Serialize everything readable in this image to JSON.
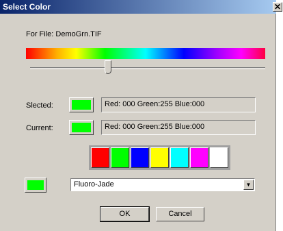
{
  "window": {
    "title": "Select Color",
    "close_glyph": "✕"
  },
  "file_label": "For File: DemoGrn.TIF",
  "slider": {
    "value_fraction": 0.33
  },
  "selected": {
    "label": "Slected:",
    "color": "#00ff00",
    "readout": "Red: 000 Green:255 Blue:000"
  },
  "current": {
    "label": "Current:",
    "color": "#00ff00",
    "readout": "Red: 000 Green:255 Blue:000"
  },
  "palette": [
    "#ff0000",
    "#00ff00",
    "#0000ff",
    "#ffff00",
    "#00ffff",
    "#ff00ff",
    "#ffffff"
  ],
  "preset": {
    "color": "#00ff00",
    "selected_option": "Fluoro-Jade",
    "arrow_icon": "chevron-down-icon"
  },
  "buttons": {
    "ok": "OK",
    "cancel": "Cancel"
  }
}
